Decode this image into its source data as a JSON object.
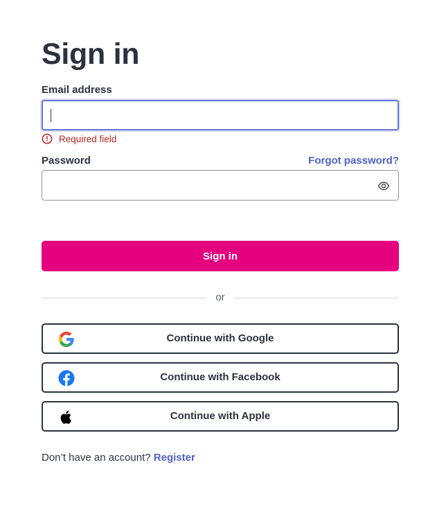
{
  "page": {
    "title": "Sign in"
  },
  "email": {
    "label": "Email address",
    "value": "",
    "placeholder": "",
    "error": "Required field"
  },
  "password": {
    "label": "Password",
    "value": "",
    "placeholder": "",
    "forgot_label": "Forgot password?"
  },
  "submit": {
    "label": "Sign in"
  },
  "divider": {
    "label": "or"
  },
  "social": {
    "google_label": "Continue with Google",
    "facebook_label": "Continue with Facebook",
    "apple_label": "Continue with Apple"
  },
  "footer": {
    "prompt": "Don’t have an account?",
    "register_label": "Register"
  },
  "icons": {
    "error": "error-circle-icon",
    "eye": "eye-icon",
    "google": "google-logo-icon",
    "facebook": "facebook-logo-icon",
    "apple": "apple-logo-icon"
  },
  "colors": {
    "primary": "#e5007d",
    "link": "#4f62c8",
    "error": "#b3261e",
    "focus_border": "#6875d6",
    "text": "#2b3240"
  }
}
